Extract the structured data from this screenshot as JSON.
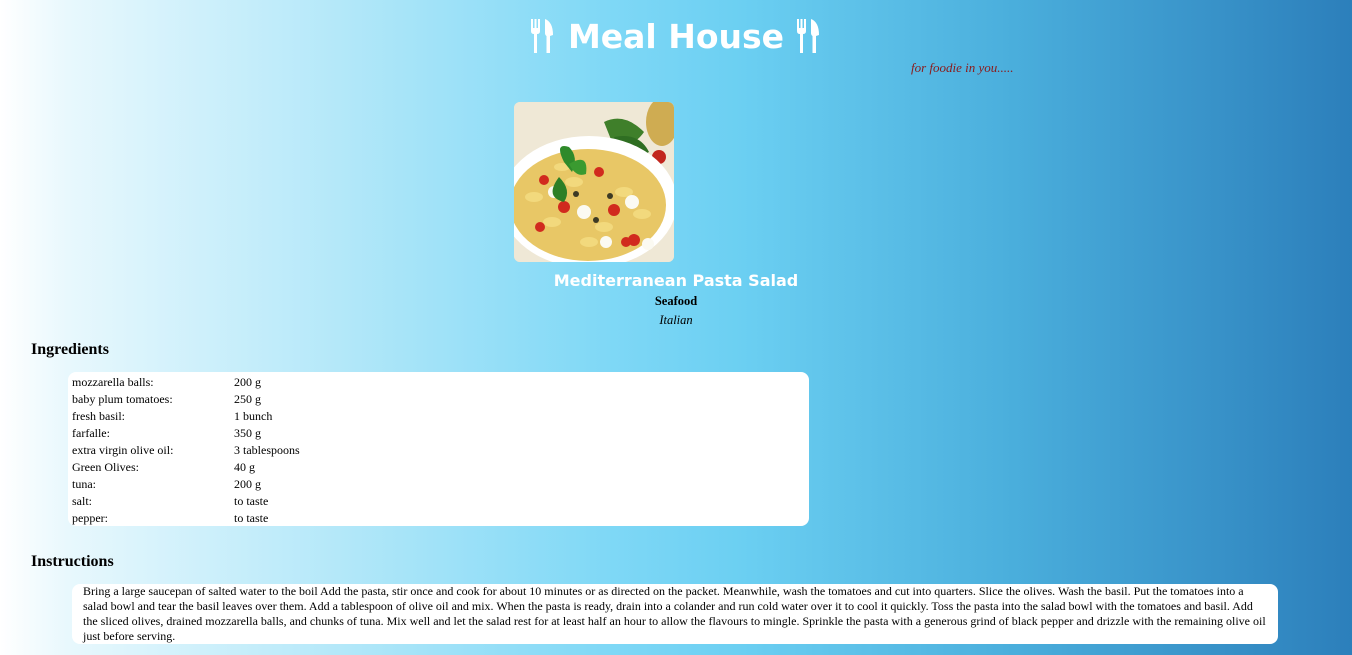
{
  "header": {
    "title": "Meal House",
    "tagline": "for foodie in you.....",
    "title_icon": "fork-knife-icon"
  },
  "recipe": {
    "image_alt": "Mediterranean pasta salad photo",
    "name": "Mediterranean Pasta Salad",
    "category": "Seafood",
    "cuisine": "Italian"
  },
  "ingredients": {
    "heading": "Ingredients",
    "items": [
      {
        "name": "mozzarella balls:",
        "measure": "200 g"
      },
      {
        "name": "baby plum tomatoes:",
        "measure": "250 g"
      },
      {
        "name": "fresh basil:",
        "measure": "1 bunch"
      },
      {
        "name": "farfalle:",
        "measure": "350 g"
      },
      {
        "name": "extra virgin olive oil:",
        "measure": "3 tablespoons"
      },
      {
        "name": "Green Olives:",
        "measure": "40 g"
      },
      {
        "name": "tuna:",
        "measure": "200 g"
      },
      {
        "name": "salt:",
        "measure": "to taste"
      },
      {
        "name": "pepper:",
        "measure": "to taste"
      }
    ]
  },
  "instructions": {
    "heading": "Instructions",
    "text": "Bring a large saucepan of salted water to the boil Add the pasta, stir once and cook for about 10 minutes or as directed on the packet. Meanwhile, wash the tomatoes and cut into quarters. Slice the olives. Wash the basil. Put the tomatoes into a salad bowl and tear the basil leaves over them. Add a tablespoon of olive oil and mix. When the pasta is ready, drain into a colander and run cold water over it to cool it quickly. Toss the pasta into the salad bowl with the tomatoes and basil. Add the sliced olives, drained mozzarella balls, and chunks of tuna. Mix well and let the salad rest for at least half an hour to allow the flavours to mingle. Sprinkle the pasta with a generous grind of black pepper and drizzle with the remaining olive oil just before serving."
  },
  "colors": {
    "title": "#ffffff",
    "tagline": "#8b1a1a",
    "gradient_start": "#ffffff",
    "gradient_mid": "#6bcff2",
    "gradient_end": "#2c7fbb"
  }
}
